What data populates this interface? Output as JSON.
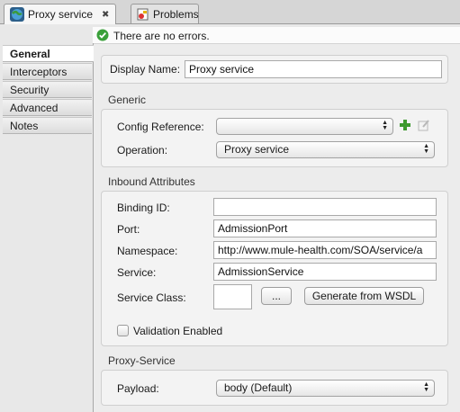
{
  "tabs": [
    {
      "label": "Proxy service",
      "icon": "globe-icon",
      "active": true
    },
    {
      "label": "Problems",
      "icon": "problems-icon",
      "active": false
    }
  ],
  "status": {
    "icon": "check-icon",
    "text": "There are no errors.",
    "color": "#3aa03a"
  },
  "nav": {
    "items": [
      {
        "label": "General",
        "active": true
      },
      {
        "label": "Interceptors"
      },
      {
        "label": "Security"
      },
      {
        "label": "Advanced"
      },
      {
        "label": "Notes"
      }
    ]
  },
  "display_name": {
    "label": "Display Name:",
    "value": "Proxy service"
  },
  "generic": {
    "title": "Generic",
    "config_reference": {
      "label": "Config Reference:",
      "value": ""
    },
    "operation": {
      "label": "Operation:",
      "value": "Proxy service"
    }
  },
  "inbound": {
    "title": "Inbound Attributes",
    "binding_id": {
      "label": "Binding ID:",
      "value": ""
    },
    "port": {
      "label": "Port:",
      "value": "AdmissionPort"
    },
    "namespace": {
      "label": "Namespace:",
      "value": "http://www.mule-health.com/SOA/service/a"
    },
    "service": {
      "label": "Service:",
      "value": "AdmissionService"
    },
    "service_class": {
      "label": "Service Class:",
      "value": "",
      "browse_label": "...",
      "generate_label": "Generate from WSDL"
    },
    "validation": {
      "label": "Validation Enabled",
      "checked": false
    }
  },
  "proxy_service": {
    "title": "Proxy-Service",
    "payload": {
      "label": "Payload:",
      "value": "body (Default)"
    }
  }
}
